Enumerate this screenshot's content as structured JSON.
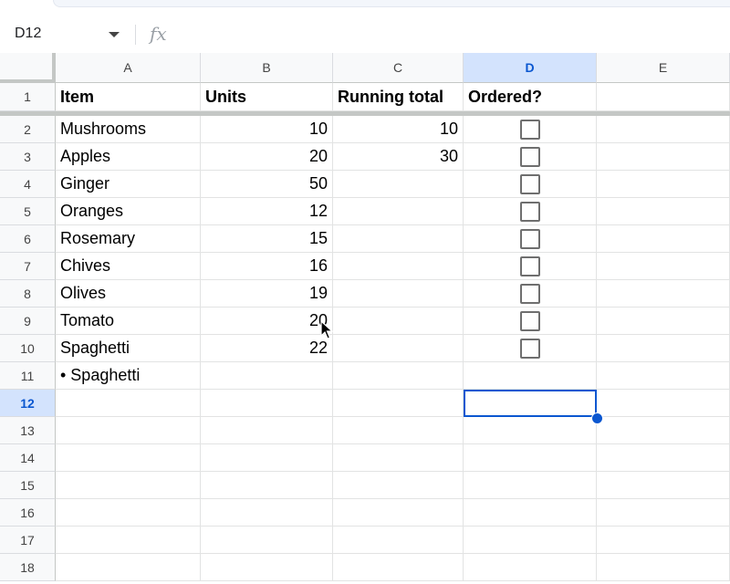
{
  "name_box": {
    "cell_ref": "D12"
  },
  "formula_bar": {
    "fx_label": "fx",
    "value": ""
  },
  "columns": [
    "A",
    "B",
    "C",
    "D",
    "E"
  ],
  "selected_column": "D",
  "selected_row": "12",
  "rows": [
    {
      "num": "1",
      "a": "Item",
      "b": "Units",
      "c": "Running total",
      "d": "Ordered?",
      "checkbox": false,
      "header": true
    },
    {
      "num": "2",
      "a": "Mushrooms",
      "b": "10",
      "c": "10",
      "checkbox": true,
      "checked": false
    },
    {
      "num": "3",
      "a": "Apples",
      "b": "20",
      "c": "30",
      "checkbox": true,
      "checked": false
    },
    {
      "num": "4",
      "a": "Ginger",
      "b": "50",
      "c": "",
      "checkbox": true,
      "checked": false
    },
    {
      "num": "5",
      "a": "Oranges",
      "b": "12",
      "c": "",
      "checkbox": true,
      "checked": false
    },
    {
      "num": "6",
      "a": "Rosemary",
      "b": "15",
      "c": "",
      "checkbox": true,
      "checked": false
    },
    {
      "num": "7",
      "a": "Chives",
      "b": "16",
      "c": "",
      "checkbox": true,
      "checked": false
    },
    {
      "num": "8",
      "a": "Olives",
      "b": "19",
      "c": "",
      "checkbox": true,
      "checked": false
    },
    {
      "num": "9",
      "a": "Tomato",
      "b": "20",
      "c": "",
      "checkbox": true,
      "checked": false
    },
    {
      "num": "10",
      "a": "Spaghetti",
      "b": "22",
      "c": "",
      "checkbox": true,
      "checked": false
    },
    {
      "num": "11",
      "a": "• Spaghetti",
      "b": "",
      "c": "",
      "checkbox": false
    },
    {
      "num": "12",
      "a": "",
      "b": "",
      "c": "",
      "checkbox": false
    },
    {
      "num": "13",
      "a": "",
      "b": "",
      "c": "",
      "checkbox": false
    },
    {
      "num": "14",
      "a": "",
      "b": "",
      "c": "",
      "checkbox": false
    },
    {
      "num": "15",
      "a": "",
      "b": "",
      "c": "",
      "checkbox": false
    },
    {
      "num": "16",
      "a": "",
      "b": "",
      "c": "",
      "checkbox": false
    },
    {
      "num": "17",
      "a": "",
      "b": "",
      "c": "",
      "checkbox": false
    },
    {
      "num": "18",
      "a": "",
      "b": "",
      "c": "",
      "checkbox": false
    }
  ],
  "colors": {
    "accent": "#0b57d0",
    "selected_header_bg": "#d3e3fd"
  }
}
